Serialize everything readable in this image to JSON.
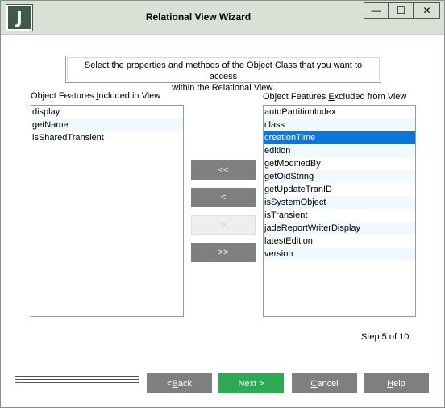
{
  "window": {
    "icon_letter": "J",
    "title": "Relational View Wizard",
    "controls": {
      "minimize": "—",
      "maximize": "☐",
      "close": "✕"
    }
  },
  "instructions": {
    "line1": "Select the properties and methods of the Object Class that you want to access",
    "line2": "within the Relational View."
  },
  "included": {
    "label_pre": "Object Features ",
    "label_ul": "I",
    "label_post": "ncluded in View",
    "items": [
      "display",
      "getName",
      "isSharedTransient"
    ]
  },
  "excluded": {
    "label_pre": "Object Features ",
    "label_ul": "E",
    "label_post": "xcluded from View",
    "selected_index": 2,
    "items": [
      "autoPartitionIndex",
      "class",
      "creationTime",
      "edition",
      "getModifiedBy",
      "getOidString",
      "getUpdateTranID",
      "isSystemObject",
      "isTransient",
      "jadeReportWriterDisplay",
      "latestEdition",
      "version"
    ]
  },
  "move_buttons": {
    "add_all": "<<",
    "add": "<",
    "remove": ">",
    "remove_all": ">>"
  },
  "step_text": "Step 5 of 10",
  "footer": {
    "back_pre": "< ",
    "back_ul": "B",
    "back_post": "ack",
    "next": "Next >",
    "cancel_ul": "C",
    "cancel_post": "ancel",
    "help_ul": "H",
    "help_post": "elp"
  },
  "colors": {
    "titlebar": "#d9e1d6",
    "selection": "#0c77d6",
    "button": "#7f7f7f",
    "next_button": "#2eaa57"
  }
}
